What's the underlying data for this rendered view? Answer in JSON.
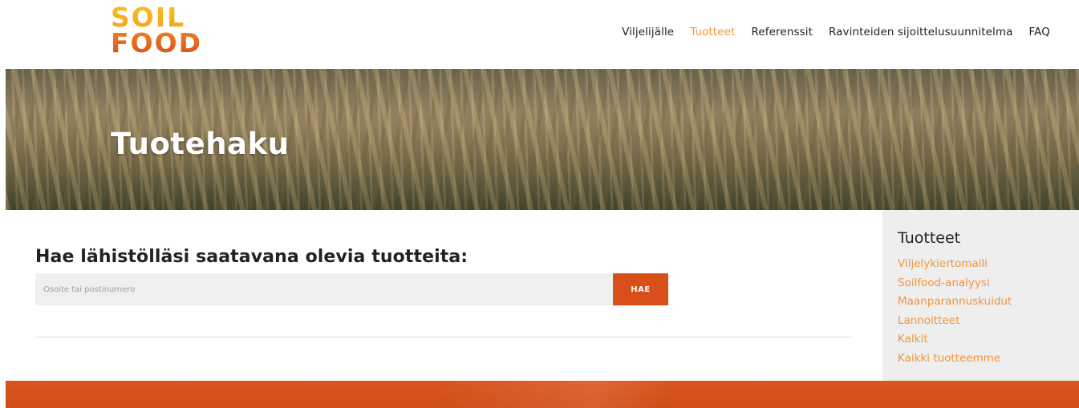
{
  "logo": {
    "line1": "SOIL",
    "line2": "FOOD"
  },
  "nav": [
    {
      "label": "Viljelijälle",
      "active": false
    },
    {
      "label": "Tuotteet",
      "active": true
    },
    {
      "label": "Referenssit",
      "active": false
    },
    {
      "label": "Ravinteiden sijoittelusuunnitelma",
      "active": false
    },
    {
      "label": "FAQ",
      "active": false
    }
  ],
  "hero": {
    "title": "Tuotehaku"
  },
  "search": {
    "heading": "Hae lähistölläsi saatavana olevia tuotteita:",
    "placeholder": "Osoite tai postinumero",
    "button_label": "HAE"
  },
  "sidebar": {
    "title": "Tuotteet",
    "links": [
      "Viljelykiertomalli",
      "Soilfood-analyysi",
      "Maanparannuskuidut",
      "Lannoitteet",
      "Kalkit",
      "Kaikki tuotteemme"
    ]
  },
  "colors": {
    "accent_orange": "#f0953a",
    "button_orange": "#d84f19",
    "footer_orange": "#d9561d"
  }
}
